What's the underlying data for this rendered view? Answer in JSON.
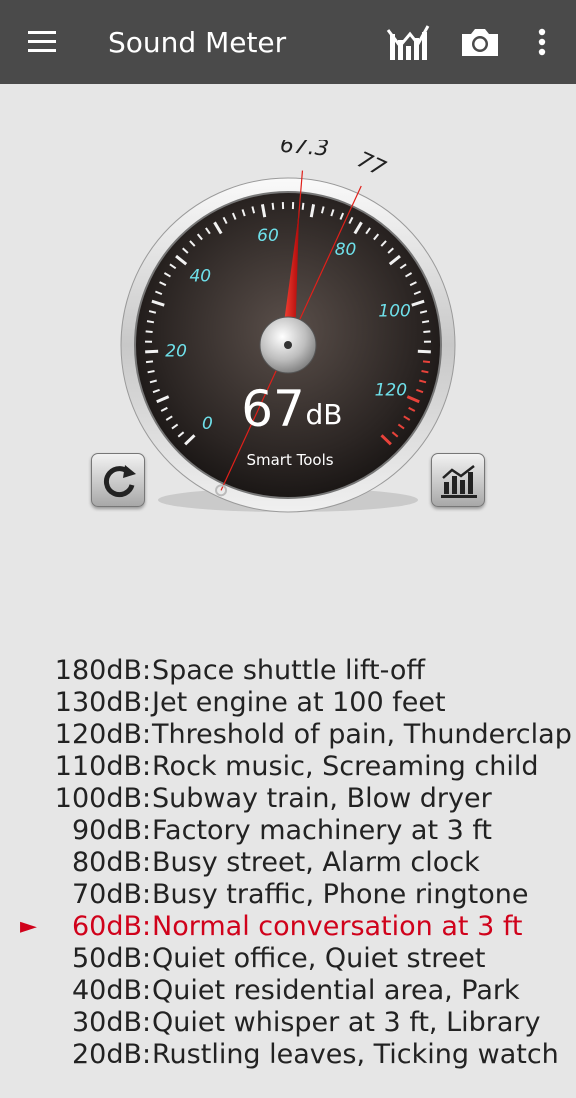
{
  "appbar": {
    "title": "Sound Meter",
    "menu_icon": "hamburger-menu-icon",
    "chart_icon": "line-chart-icon",
    "camera_icon": "camera-icon",
    "overflow_icon": "more-vertical-icon"
  },
  "gauge": {
    "current_value": "67",
    "unit": "dB",
    "brand": "Smart Tools",
    "needle_value": 67.3,
    "needle_label": "67.3",
    "max_value": 77,
    "max_label": "77",
    "scale_labels": [
      "0",
      "20",
      "40",
      "60",
      "80",
      "100",
      "120"
    ],
    "scale_min": 0,
    "scale_max": 130,
    "reset_icon": "refresh-icon",
    "chart_icon": "bar-chart-icon"
  },
  "reference": {
    "items": [
      {
        "db": "180dB",
        "desc": "Space shuttle lift-off"
      },
      {
        "db": "130dB",
        "desc": "Jet engine at 100 feet"
      },
      {
        "db": "120dB",
        "desc": "Threshold of pain, Thunderclap"
      },
      {
        "db": "110dB",
        "desc": "Rock music, Screaming child"
      },
      {
        "db": "100dB",
        "desc": "Subway train, Blow dryer"
      },
      {
        "db": "90dB",
        "desc": "Factory machinery at 3 ft"
      },
      {
        "db": "80dB",
        "desc": "Busy street, Alarm clock"
      },
      {
        "db": "70dB",
        "desc": "Busy traffic, Phone ringtone"
      },
      {
        "db": "60dB",
        "desc": "Normal conversation at 3 ft"
      },
      {
        "db": "50dB",
        "desc": "Quiet office, Quiet street"
      },
      {
        "db": "40dB",
        "desc": "Quiet residential area, Park"
      },
      {
        "db": "30dB",
        "desc": "Quiet whisper at 3 ft, Library"
      },
      {
        "db": "20dB",
        "desc": "Rustling leaves, Ticking watch"
      }
    ],
    "active_index": 8,
    "marker": "►",
    "separator": ":"
  },
  "colors": {
    "appbar": "#4a4a4a",
    "background": "#e6e6e6",
    "accent_red": "#d0021b",
    "scale_cyan": "#6fe0ea"
  }
}
